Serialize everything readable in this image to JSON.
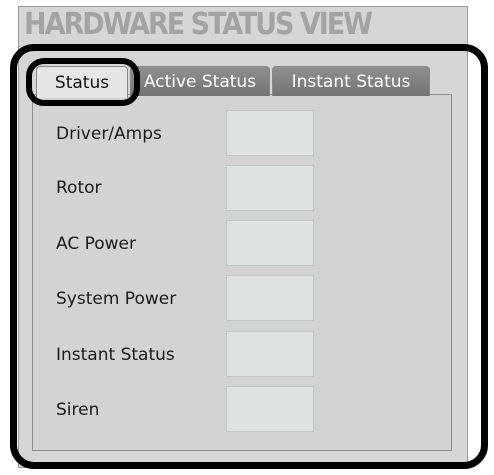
{
  "header": {
    "title": "HARDWARE STATUS VIEW"
  },
  "tabs": [
    {
      "label": "Status",
      "selected": true
    },
    {
      "label": "Active Status",
      "selected": false
    },
    {
      "label": "Instant Status",
      "selected": false
    }
  ],
  "rows": [
    {
      "label": "Driver/Amps",
      "value": ""
    },
    {
      "label": "Rotor",
      "value": ""
    },
    {
      "label": "AC Power",
      "value": ""
    },
    {
      "label": "System Power",
      "value": ""
    },
    {
      "label": "Instant Status",
      "value": ""
    },
    {
      "label": "Siren",
      "value": ""
    }
  ],
  "colors": {
    "panel_bg": "#d6d6d6",
    "title_text": "#a3a3a3",
    "tab_inactive": "#808080",
    "tab_active": "#e6e6e6",
    "field_bg": "#dfe2e2",
    "highlight": "#000000"
  }
}
